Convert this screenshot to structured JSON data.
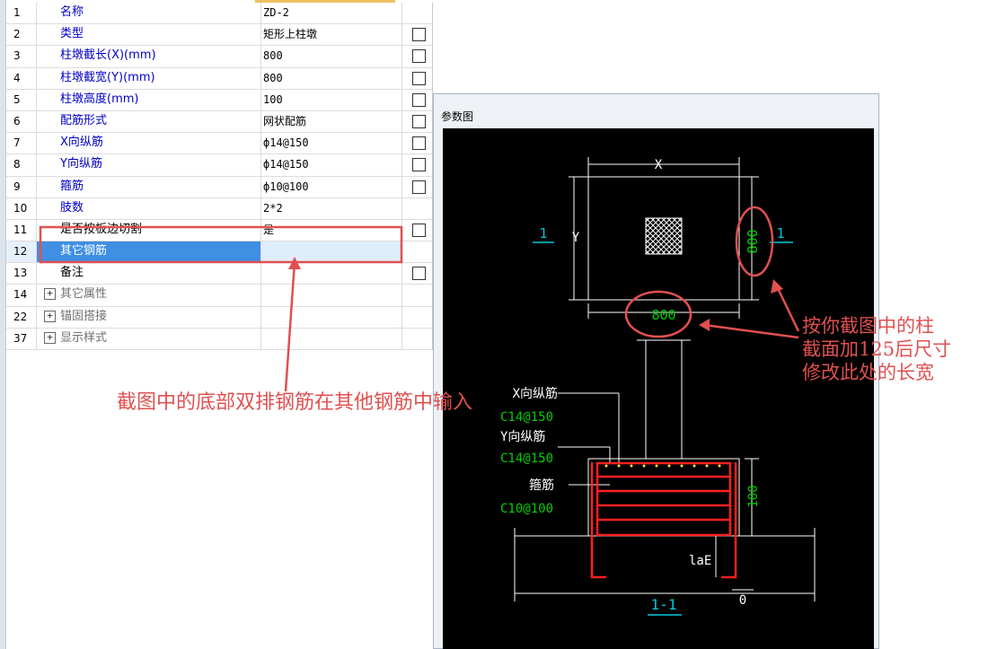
{
  "grid": {
    "rows": [
      {
        "num": "1",
        "label": "名称",
        "value": "ZD-2",
        "checkbox": false
      },
      {
        "num": "2",
        "label": "类型",
        "value": "矩形上柱墩",
        "checkbox": true
      },
      {
        "num": "3",
        "label": "柱墩截长(X)(mm)",
        "value": "800",
        "checkbox": true
      },
      {
        "num": "4",
        "label": "柱墩截宽(Y)(mm)",
        "value": "800",
        "checkbox": true
      },
      {
        "num": "5",
        "label": "柱墩高度(mm)",
        "value": "100",
        "checkbox": true
      },
      {
        "num": "6",
        "label": "配筋形式",
        "value": "网状配筋",
        "checkbox": true
      },
      {
        "num": "7",
        "label": "X向纵筋",
        "value": "ф14@150",
        "checkbox": true
      },
      {
        "num": "8",
        "label": "Y向纵筋",
        "value": "ф14@150",
        "checkbox": true
      },
      {
        "num": "9",
        "label": "箍筋",
        "value": "ф10@100",
        "checkbox": true
      },
      {
        "num": "10",
        "label": "肢数",
        "value": "2*2",
        "checkbox": false
      },
      {
        "num": "11",
        "label": "是否按板边切割",
        "value": "是",
        "checkbox": true
      },
      {
        "num": "12",
        "label": "其它钢筋",
        "value": "",
        "checkbox": false
      },
      {
        "num": "13",
        "label": "备注",
        "value": "",
        "checkbox": true
      },
      {
        "num": "14",
        "label": "其它属性",
        "value": "",
        "group": true
      },
      {
        "num": "22",
        "label": "锚固搭接",
        "value": "",
        "group": true
      },
      {
        "num": "37",
        "label": "显示样式",
        "value": "",
        "group": true
      }
    ]
  },
  "figure": {
    "title": "参数图",
    "dim_x": "X",
    "dim_y": "Y",
    "width_value": "800",
    "height_value": "800",
    "section_mark": "1",
    "section_label": "1-1",
    "x_bar_label": "X向纵筋",
    "x_bar_value": "C14@150",
    "y_bar_label": "Y向纵筋",
    "y_bar_value": "C14@150",
    "stirrup_label": "箍筋",
    "stirrup_value": "C10@100",
    "depth_value": "100",
    "lae_label": "laE",
    "zero_label": "0"
  },
  "annotations": {
    "bottom_text": "截图中的底部双排钢筋在其他钢筋中输入",
    "right_line1": "按你截图中的柱",
    "right_line2": "截面加125后尺寸",
    "right_line3": "修改此处的长宽"
  },
  "colors": {
    "annotation_red": "#e05050",
    "selected_row": "#3f8fe3",
    "label_blue": "#0000c8",
    "cad_green": "#00d000",
    "cad_cyan": "#00c8e0",
    "cad_red": "#ff2020"
  }
}
